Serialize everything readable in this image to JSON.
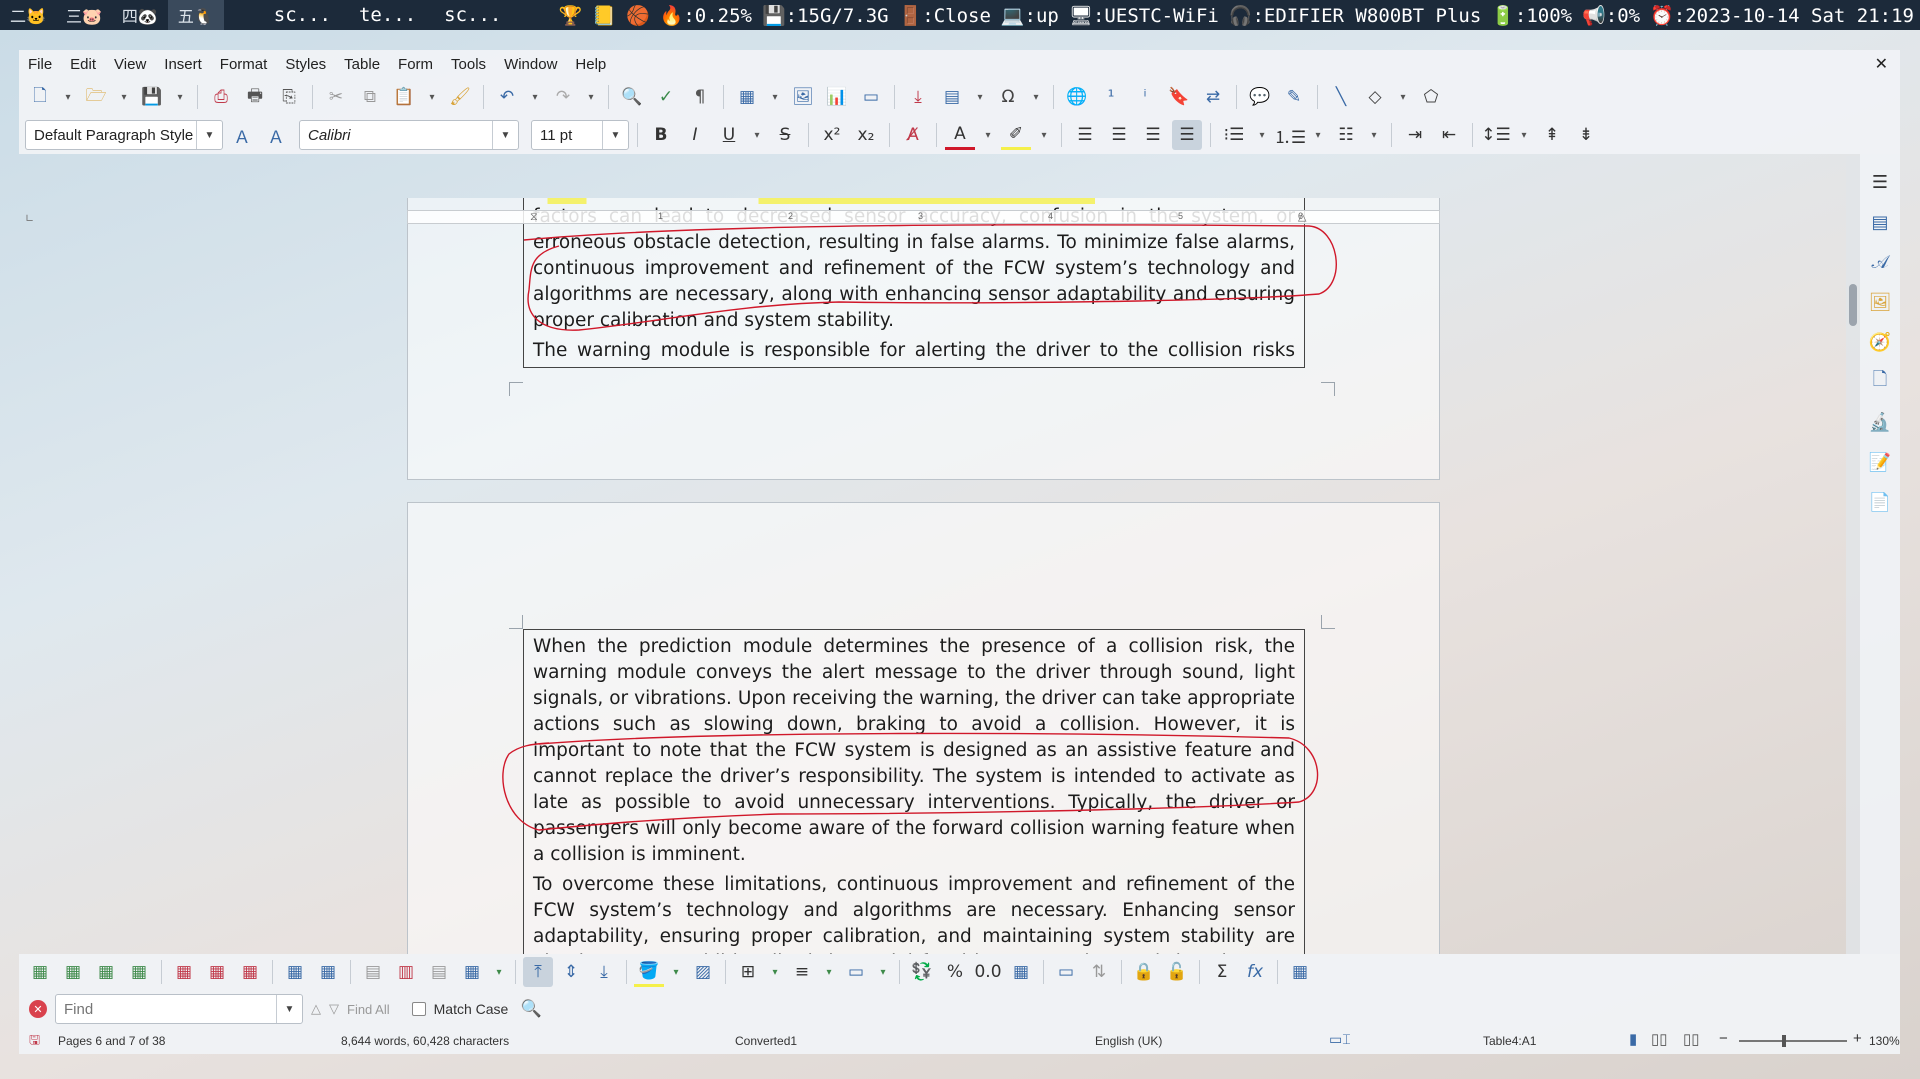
{
  "system_panel": {
    "workspaces": [
      {
        "label": "二🐱",
        "active": false
      },
      {
        "label": "三🐷",
        "active": false
      },
      {
        "label": "四🐼",
        "active": false
      },
      {
        "label": "五🐧",
        "active": true
      }
    ],
    "window_titles": [
      "sc...",
      "te...",
      "sc..."
    ],
    "status_items": [
      "🏆",
      "📒",
      "🏀",
      "🔥:0.25%",
      "💾:15G/7.3G",
      "🚪:Close",
      "💻:up",
      "🖥:UESTC-WiFi",
      "🎧:EDIFIER W800BT Plus",
      "🔋:100%",
      "📢:0%",
      "⏰:2023-10-14 Sat 21:19"
    ]
  },
  "menubar": {
    "items": [
      "File",
      "Edit",
      "View",
      "Insert",
      "Format",
      "Styles",
      "Table",
      "Form",
      "Tools",
      "Window",
      "Help"
    ],
    "close_label": "✕"
  },
  "formatting": {
    "paragraph_style": "Default Paragraph Style",
    "font_name": "Calibri",
    "font_size": "11 pt"
  },
  "document": {
    "page1_table": {
      "paragraphs": [
        "factors can lead to decreased sensor accuracy, confusion in the system, or erroneous obstacle detection, resulting in false alarms. To minimize false alarms, continuous improvement and refinement of the FCW system’s technology and algorithms are necessary, along with enhancing sensor adaptability and ensuring proper calibration and system stability.",
        "The warning module is responsible for alerting the driver to the collision risks ahead."
      ]
    },
    "page2_table": {
      "paragraphs": [
        "When the prediction module determines the presence of a collision risk, the warning module conveys the alert message to the driver through sound, light signals, or vibrations. Upon receiving the warning, the driver can take appropriate actions such as slowing down, braking to avoid a collision. However, it is important to note that the FCW system is designed as an assistive feature and cannot replace the driver’s responsibility. The system is intended to activate as late as possible to avoid unnecessary interventions. Typically, the driver or passengers will only become aware of the forward collision warning feature when a collision is imminent.",
        "To overcome these limitations, continuous improvement and refinement of the FCW system’s technology and algorithms are necessary. Enhancing sensor adaptability, ensuring proper calibration, and maintaining system stability are also important. Additionally, it is crucial for drivers to understand that the FCW system is an aid and"
      ]
    },
    "ruler_numbers": [
      "1",
      "2",
      "3",
      "4",
      "5",
      "6"
    ]
  },
  "findbar": {
    "placeholder": "Find",
    "find_all_label": "Find All",
    "match_case_label": "Match Case"
  },
  "statusbar": {
    "pages": "Pages 6 and 7 of 38",
    "word_count": "8,644 words, 60,428 characters",
    "page_style": "Converted1",
    "language": "English (UK)",
    "cell": "Table4:A1",
    "zoom": "130%"
  },
  "colors": {
    "panel_bg": "#1c2a3a",
    "annotation_red": "#d0182a",
    "highlight_yellow": "#f5f04a"
  }
}
